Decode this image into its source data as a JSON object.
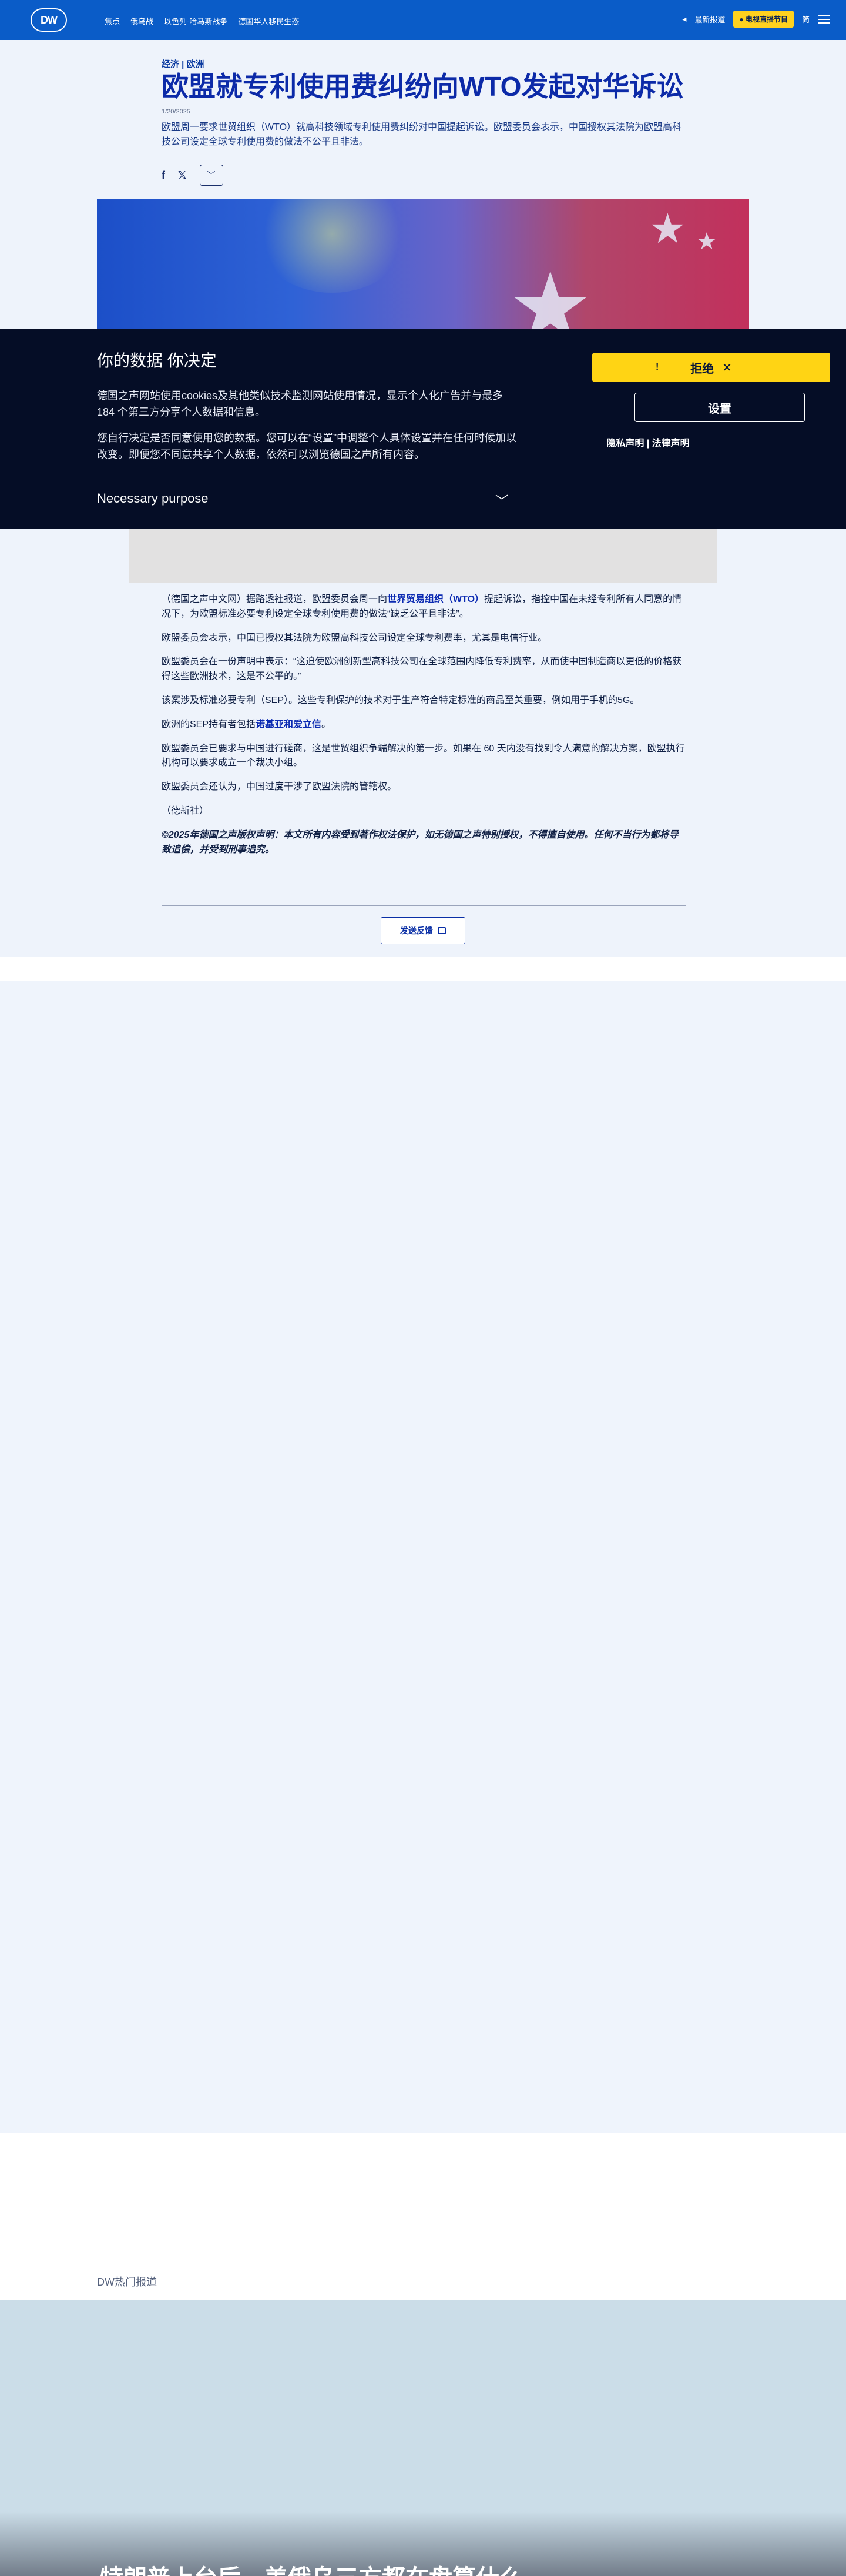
{
  "header": {
    "logo": "DW",
    "nav": [
      "焦点",
      "俄乌战",
      "以色列-哈马斯战争",
      "德国华人移民生态"
    ],
    "news_label": "最新报道",
    "live_label": "● 电视直播节目",
    "lang": "简"
  },
  "article": {
    "kicker": "经济 | 欧洲",
    "title": "欧盟就专利使用费纠纷向WTO发起对华诉讼",
    "date": "1/20/2025",
    "lead": "欧盟周一要求世贸组织（WTO）就高科技领域专利使用费纠纷对中国提起诉讼。欧盟委员会表示，中国授权其法院为欧盟高科技公司设定全球专利使用费的做法不公平且非法。",
    "share": {
      "facebook": "f",
      "x": "𝕏",
      "more": "﹀"
    }
  },
  "consent": {
    "title": "你的数据 你决定",
    "p1": "德国之声网站使用cookies及其他类似技术监测网站使用情况，显示个人化广告并与最多184 个第三方分享个人数据和信息。",
    "p2": "您自行决定是否同意使用您的数据。您可以在“设置”中调整个人具体设置并在任何时候加以改变。即便您不同意共享个人数据，依然可以浏览德国之声所有内容。",
    "purpose": "Necessary purpose",
    "purpose_chevron": "﹀",
    "reject": "拒绝",
    "reject_mark": "!",
    "reject_x": "✕",
    "settings": "设置",
    "legal": "隐私声明 | 法律声明"
  },
  "body": {
    "p1_a": "（德国之声中文网）据路透社报道，欧盟委员会周一向",
    "p1_link": "世界贸易组织（WTO）",
    "p1_b": "提起诉讼，指控中国在未经专利所有人同意的情况下，为欧盟标准必要专利设定全球专利使用费的做法“缺乏公平且非法”。",
    "p2": "欧盟委员会表示，中国已授权其法院为欧盟高科技公司设定全球专利费率，尤其是电信行业。",
    "p3": "欧盟委员会在一份声明中表示：“这迫使欧洲创新型高科技公司在全球范围内降低专利费率，从而使中国制造商以更低的价格获得这些欧洲技术，这是不公平的。”",
    "p4": "该案涉及标准必要专利（SEP）。这些专利保护的技术对于生产符合特定标准的商品至关重要，例如用于手机的5G。",
    "p5_a": "欧洲的SEP持有者包括",
    "p5_link": "诺基亚和爱立信",
    "p5_b": "。",
    "p6": "欧盟委员会已要求与中国进行磋商，这是世贸组织争端解决的第一步。如果在 60 天内没有找到令人满意的解决方案，欧盟执行机构可以要求成立一个裁决小组。",
    "p7": "欧盟委员会还认为，中国过度干涉了欧盟法院的管辖权。",
    "p8": "（德新社）",
    "copyright": "©2025年德国之声版权声明：本文所有内容受到著作权法保护，如无德国之声特别授权，不得擅自使用。任何不当行为都将导致追偿，并受到刑事追究。",
    "feedback": "发送反馈"
  },
  "sections": {
    "hot": "DW热门报道",
    "hot_title": "特朗普上台后，美俄乌三方都在盘算什么"
  }
}
